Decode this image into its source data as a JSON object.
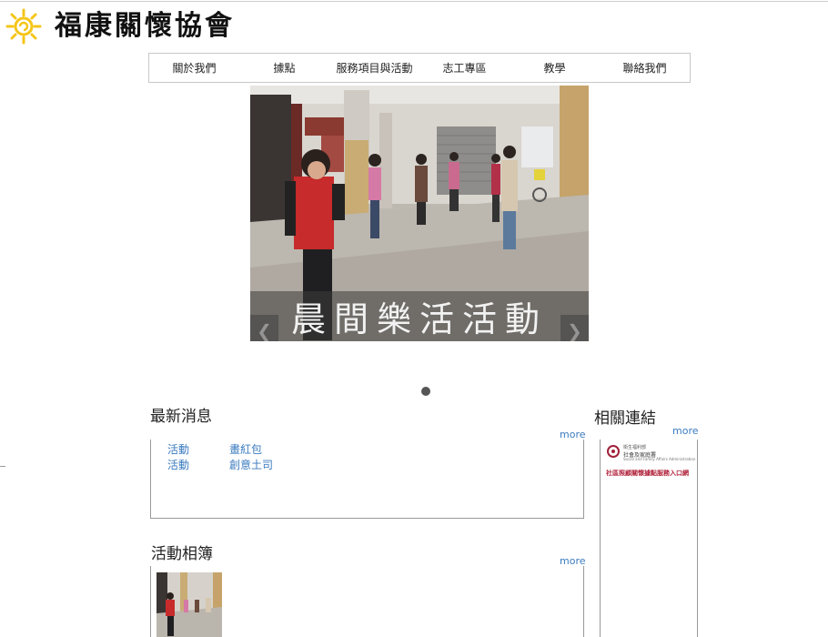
{
  "site": {
    "name": "福康關懷協會",
    "logo_icon": "sun-icon",
    "accent": "#f5c518"
  },
  "nav": {
    "items": [
      {
        "label": "關於我們"
      },
      {
        "label": "據點"
      },
      {
        "label": "服務項目與活動"
      },
      {
        "label": "志工專區"
      },
      {
        "label": "教學"
      },
      {
        "label": "聯絡我們"
      }
    ]
  },
  "banner": {
    "caption": "晨間樂活活動",
    "prev_arrow": "❮",
    "next_arrow": "❯",
    "slide_count": 1
  },
  "news": {
    "title": "最新消息",
    "more_label": "more",
    "items": [
      {
        "category": "活動",
        "title": "畫紅包"
      },
      {
        "category": "活動",
        "title": "創意土司"
      }
    ]
  },
  "album": {
    "title": "活動相簿",
    "more_label": "more"
  },
  "links": {
    "title": "相關連結",
    "more_label": "more",
    "items": [
      {
        "org_line1": "衛生福利部",
        "org_line2": "社會及家庭署",
        "org_line3": "Social and Family Affairs Administration",
        "caption": "社區照顧關懷據點服務入口網"
      }
    ]
  },
  "colors": {
    "link": "#3b7bbf",
    "border": "#999999",
    "link_brand": "#a0213a"
  }
}
